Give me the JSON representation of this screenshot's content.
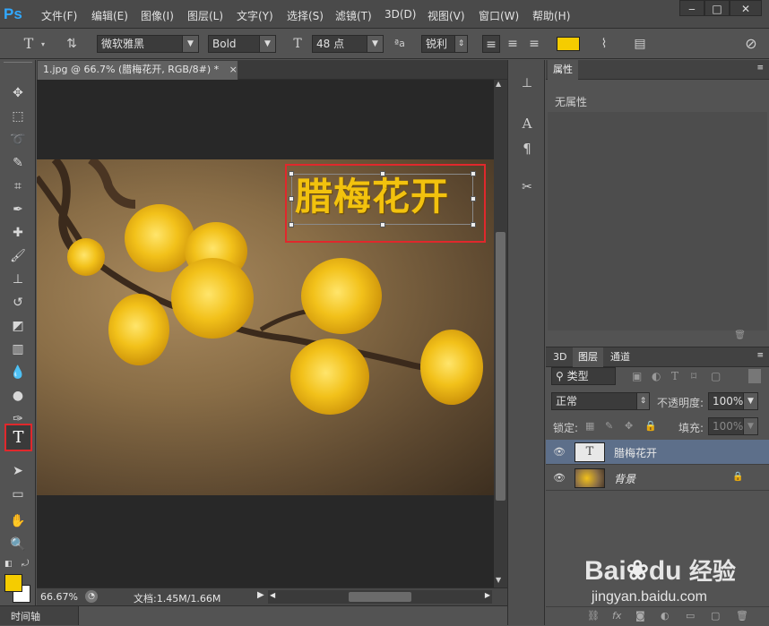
{
  "app": {
    "logo": "Ps"
  },
  "menu": [
    "文件(F)",
    "编辑(E)",
    "图像(I)",
    "图层(L)",
    "文字(Y)",
    "选择(S)",
    "滤镜(T)",
    "3D(D)",
    "视图(V)",
    "窗口(W)",
    "帮助(H)"
  ],
  "window_controls": {
    "minimize": "‒",
    "maximize": "□",
    "close": "✕"
  },
  "options": {
    "font_family": "微软雅黑",
    "font_style": "Bold",
    "font_size": "48 点",
    "aa_label": "ªa",
    "antialias": "锐利",
    "text_color": "#f5cc00"
  },
  "document": {
    "tab_title": "1.jpg @ 66.7% (腊梅花开, RGB/8#) *",
    "tab_close": "×",
    "headline": "腊梅花开"
  },
  "status": {
    "zoom": "66.67%",
    "doc_info": "文档:1.45M/1.66M"
  },
  "timeline": {
    "label": "时间轴"
  },
  "properties": {
    "tab": "属性",
    "empty_text": "无属性"
  },
  "layers_panel": {
    "tabs": [
      "3D",
      "图层",
      "通道"
    ],
    "filter_kind": "类型",
    "blend_mode": "正常",
    "opacity_label": "不透明度:",
    "opacity_value": "100%",
    "lock_label": "锁定:",
    "fill_label": "填充:",
    "fill_value": "100%",
    "layers": [
      {
        "name": "腊梅花开",
        "type": "text",
        "selected": true
      },
      {
        "name": "背景",
        "type": "image",
        "locked": true
      }
    ]
  },
  "colors": {
    "foreground": "#f5cc00",
    "background": "#ffffff",
    "highlight_box": "#e0282c",
    "selected_layer": "#5d6f8a"
  },
  "watermark": {
    "brand": "Bai",
    "brand2": "du",
    "suffix": "经验",
    "url": "jingyan.baidu.com"
  }
}
